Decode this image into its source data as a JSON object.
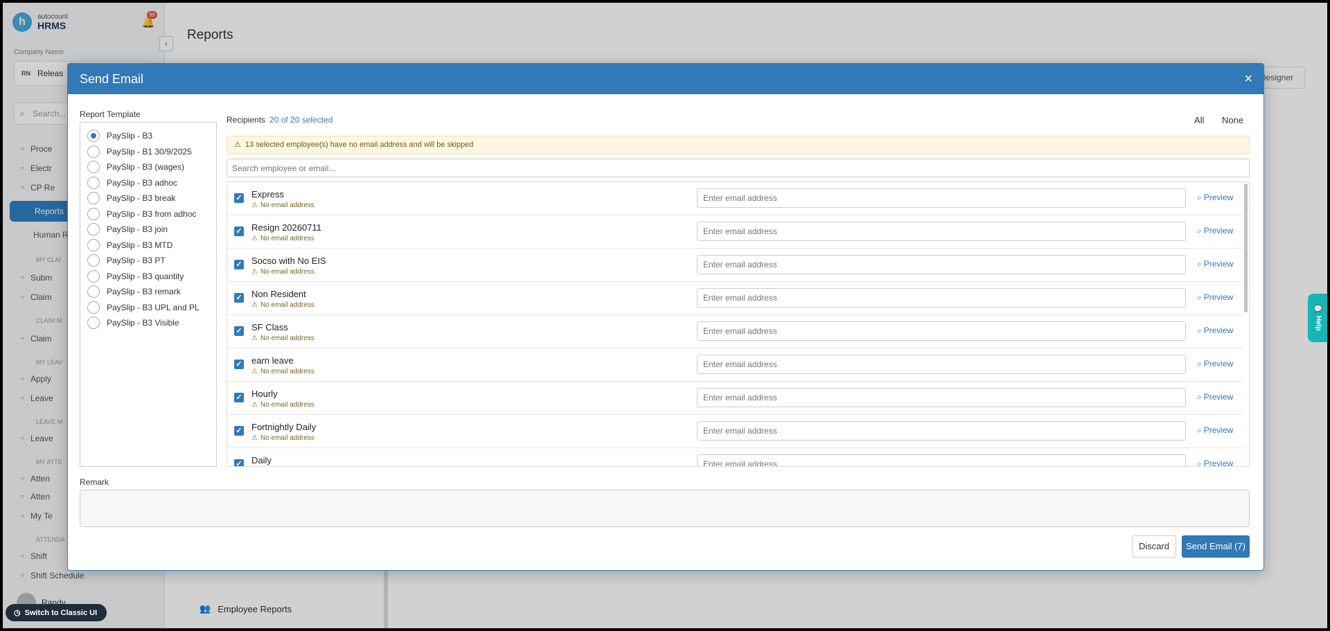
{
  "app": {
    "logo_letter": "h",
    "logo_brand_top": "autocount",
    "logo_brand": "HRMS",
    "notification_count": "99",
    "company_label": "Company Name",
    "company_initials": "RN",
    "company_name": "Releas",
    "search_placeholder": "Search...",
    "page_title": "Reports",
    "designer_label": "Designer",
    "employee_reports_label": "Employee Reports",
    "user_name": "Randy",
    "switch_ui_label": "Switch to Classic UI",
    "help_label": "Help"
  },
  "sidebar": {
    "items_top": [
      "Proce",
      "Electr",
      "CP Re"
    ],
    "active": "Reports",
    "hr": "Human R",
    "sections": [
      {
        "head": "MY CLAI",
        "items": [
          "Subm",
          "Claim"
        ]
      },
      {
        "head": "CLAIM M",
        "items": [
          "Claim"
        ]
      },
      {
        "head": "MY LEAV",
        "items": [
          "Apply",
          "Leave"
        ]
      },
      {
        "head": "LEAVE M",
        "items": [
          "Leave"
        ]
      },
      {
        "head": "MY ATTE",
        "items": [
          "Atten",
          "Atten",
          "My Te"
        ]
      },
      {
        "head": "ATTENDA",
        "items": [
          "Shift",
          "Shift Schedule"
        ]
      }
    ]
  },
  "modal": {
    "title": "Send Email",
    "close_icon": "×",
    "template_label": "Report Template",
    "templates": [
      "PaySlip - B3",
      "PaySlip - B1 30/9/2025",
      "PaySlip - B3 (wages)",
      "PaySlip - B3 adhoc",
      "PaySlip - B3 break",
      "PaySlip - B3 from adhoc",
      "PaySlip - B3 join",
      "PaySlip - B3 MTD",
      "PaySlip - B3 PT",
      "PaySlip - B3 quantity",
      "PaySlip - B3 remark",
      "PaySlip - B3 UPL and PL",
      "PaySlip - B3 Visible"
    ],
    "selected_template_index": 0,
    "recipients_label": "Recipients",
    "recipients_count": "20 of 20 selected",
    "all_label": "All",
    "none_label": "None",
    "warning_text": "13 selected employee(s) have no email address and will be skipped",
    "search_placeholder": "Search employee or email...",
    "email_placeholder": "Enter email address",
    "no_email_text": "No email address",
    "preview_label": "Preview",
    "employees": [
      {
        "name": "Express",
        "no_email": true
      },
      {
        "name": "Resign 20260711",
        "no_email": true
      },
      {
        "name": "Socso with No EIS",
        "no_email": true
      },
      {
        "name": "Non Resident",
        "no_email": true
      },
      {
        "name": "SF Class",
        "no_email": true
      },
      {
        "name": "earn leave",
        "no_email": true
      },
      {
        "name": "Hourly",
        "no_email": true
      },
      {
        "name": "Fortnightly Daily",
        "no_email": true
      },
      {
        "name": "Daily",
        "no_email": true
      }
    ],
    "remark_label": "Remark",
    "discard_label": "Discard",
    "send_label": "Send Email (7)"
  },
  "colors": {
    "accent": "#3279b7",
    "warning_bg": "#fdf6e1",
    "help_tab": "#17b6b6"
  }
}
